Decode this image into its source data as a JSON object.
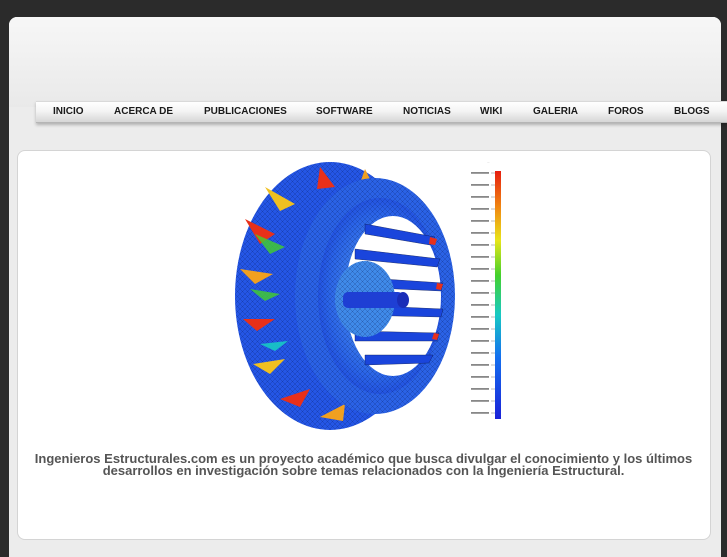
{
  "nav": {
    "items": [
      {
        "label": "INICIO"
      },
      {
        "label": "ACERCA DE"
      },
      {
        "label": "PUBLICACIONES"
      },
      {
        "label": "SOFTWARE"
      },
      {
        "label": "NOTICIAS"
      },
      {
        "label": "WIKI"
      },
      {
        "label": "GALERIA"
      },
      {
        "label": "FOROS"
      },
      {
        "label": "BLOGS"
      }
    ]
  },
  "hero": {
    "image_name": "fan-stress-simulation",
    "caption": "Ingenieros Estructurales.com es un proyecto académico que busca divulgar el conocimiento y los últimos desarrollos en investigación sobre temas relacionados con la Ingeniería Estructural."
  },
  "colors": {
    "background": "#2b2b2b",
    "page": "#ececec",
    "nav_text": "#1a1a1a",
    "caption_text": "#555555",
    "stress_low": "#1d3df0",
    "stress_high": "#e8301a"
  }
}
